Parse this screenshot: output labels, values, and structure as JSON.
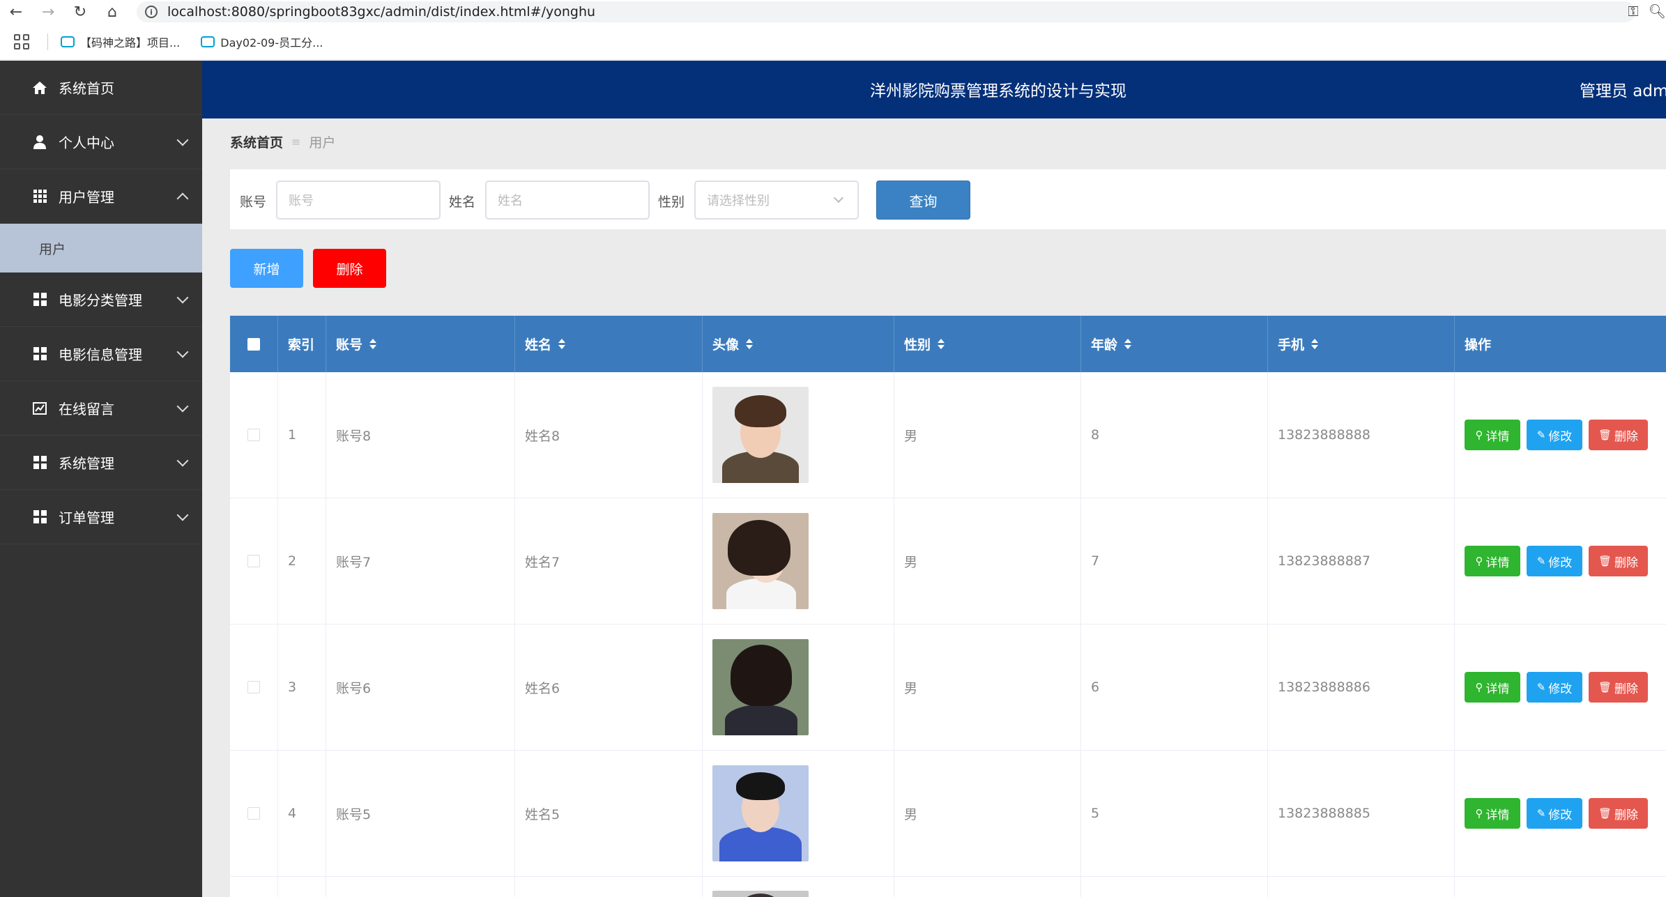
{
  "browser": {
    "url": "localhost:8080/springboot83gxc/admin/dist/index.html#/yonghu",
    "bookmarks": [
      "【码神之路】项目...",
      "Day02-09-员工分..."
    ]
  },
  "sidebar": {
    "items": [
      {
        "label": "系统首页",
        "icon": "home-icon"
      },
      {
        "label": "个人中心",
        "icon": "user-icon"
      },
      {
        "label": "用户管理",
        "icon": "grid-icon"
      },
      {
        "label": "电影分类管理",
        "icon": "grid-icon"
      },
      {
        "label": "电影信息管理",
        "icon": "grid-icon"
      },
      {
        "label": "在线留言",
        "icon": "chart-icon"
      },
      {
        "label": "系统管理",
        "icon": "grid-icon"
      },
      {
        "label": "订单管理",
        "icon": "grid-icon"
      }
    ],
    "sub_item": "用户"
  },
  "header": {
    "title": "洋州影院购票管理系统的设计与实现",
    "admin": "管理员 admi"
  },
  "breadcrumb": {
    "home": "系统首页",
    "current": "用户"
  },
  "search": {
    "account_label": "账号",
    "account_placeholder": "账号",
    "name_label": "姓名",
    "name_placeholder": "姓名",
    "gender_label": "性别",
    "gender_placeholder": "请选择性别",
    "query_button": "查询"
  },
  "actions": {
    "add_button": "新增",
    "delete_button": "删除"
  },
  "table": {
    "columns": [
      "索引",
      "账号",
      "姓名",
      "头像",
      "性别",
      "年龄",
      "手机",
      "操作"
    ],
    "rows": [
      {
        "index": "1",
        "account": "账号8",
        "name": "姓名8",
        "gender": "男",
        "age": "8",
        "phone": "13823888888"
      },
      {
        "index": "2",
        "account": "账号7",
        "name": "姓名7",
        "gender": "男",
        "age": "7",
        "phone": "13823888887"
      },
      {
        "index": "3",
        "account": "账号6",
        "name": "姓名6",
        "gender": "男",
        "age": "6",
        "phone": "13823888886"
      },
      {
        "index": "4",
        "account": "账号5",
        "name": "姓名5",
        "gender": "男",
        "age": "5",
        "phone": "13823888885"
      }
    ],
    "ops": {
      "detail": "详情",
      "edit": "修改",
      "remove": "删除"
    }
  },
  "colors": {
    "header_bg": "#04307a",
    "sidebar_bg": "#333333",
    "table_header_bg": "#3b7bbd",
    "detail_btn": "#2fb52f",
    "edit_btn": "#1fa3f0",
    "remove_btn": "#e4574f"
  }
}
